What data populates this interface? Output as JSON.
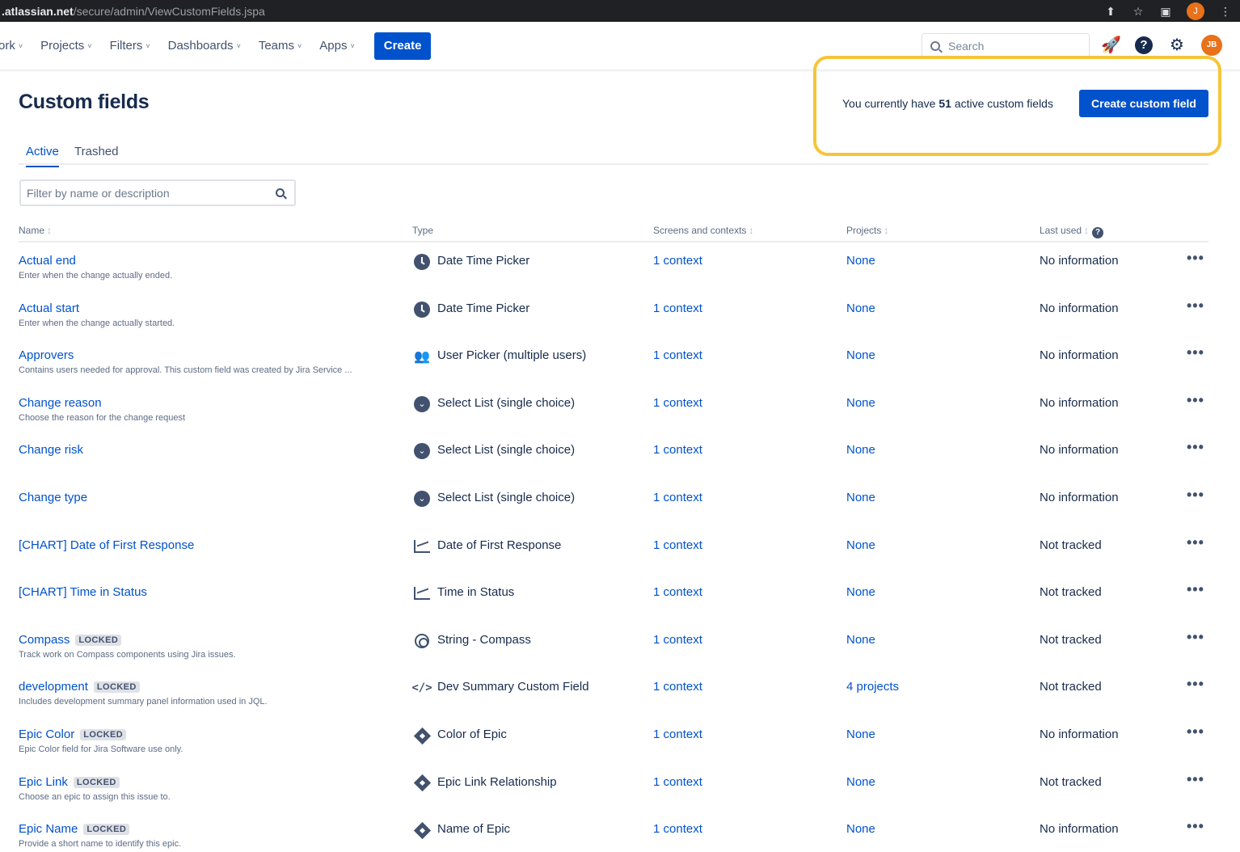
{
  "browser": {
    "url_host": ".atlassian.net",
    "url_path": "/secure/admin/ViewCustomFields.jspa",
    "profile_initial": "J"
  },
  "nav": {
    "items": [
      {
        "label": "ork"
      },
      {
        "label": "Projects"
      },
      {
        "label": "Filters"
      },
      {
        "label": "Dashboards"
      },
      {
        "label": "Teams"
      },
      {
        "label": "Apps"
      }
    ],
    "create_label": "Create",
    "search_placeholder": "Search",
    "avatar_initials": "JB"
  },
  "page": {
    "title": "Custom fields",
    "count_prefix": "You currently have",
    "count_value": "51",
    "count_suffix": "active custom fields",
    "create_button": "Create custom field",
    "tabs": [
      {
        "label": "Active",
        "active": true
      },
      {
        "label": "Trashed",
        "active": false
      }
    ],
    "filter_placeholder": "Filter by name or description"
  },
  "table": {
    "columns": {
      "name": "Name",
      "type": "Type",
      "screens": "Screens and contexts",
      "projects": "Projects",
      "last_used": "Last used"
    },
    "lock_label": "LOCKED",
    "rows": [
      {
        "name": "Actual end",
        "locked": false,
        "desc": "Enter when the change actually ended.",
        "type_icon": "clock",
        "type": "Date Time Picker",
        "context": "1 context",
        "projects": "None",
        "last_used": "No information"
      },
      {
        "name": "Actual start",
        "locked": false,
        "desc": "Enter when the change actually started.",
        "type_icon": "clock",
        "type": "Date Time Picker",
        "context": "1 context",
        "projects": "None",
        "last_used": "No information"
      },
      {
        "name": "Approvers",
        "locked": false,
        "desc": "Contains users needed for approval. This custom field was created by Jira Service ...",
        "type_icon": "users",
        "type": "User Picker (multiple users)",
        "context": "1 context",
        "projects": "None",
        "last_used": "No information"
      },
      {
        "name": "Change reason",
        "locked": false,
        "desc": "Choose the reason for the change request",
        "type_icon": "check",
        "type": "Select List (single choice)",
        "context": "1 context",
        "projects": "None",
        "last_used": "No information"
      },
      {
        "name": "Change risk",
        "locked": false,
        "desc": "",
        "type_icon": "check",
        "type": "Select List (single choice)",
        "context": "1 context",
        "projects": "None",
        "last_used": "No information"
      },
      {
        "name": "Change type",
        "locked": false,
        "desc": "",
        "type_icon": "check",
        "type": "Select List (single choice)",
        "context": "1 context",
        "projects": "None",
        "last_used": "No information"
      },
      {
        "name": "[CHART] Date of First Response",
        "locked": false,
        "desc": "",
        "type_icon": "chart",
        "type": "Date of First Response",
        "context": "1 context",
        "projects": "None",
        "last_used": "Not tracked"
      },
      {
        "name": "[CHART] Time in Status",
        "locked": false,
        "desc": "",
        "type_icon": "chart",
        "type": "Time in Status",
        "context": "1 context",
        "projects": "None",
        "last_used": "Not tracked"
      },
      {
        "name": "Compass",
        "locked": true,
        "desc": "Track work on Compass components using Jira issues.",
        "type_icon": "ring",
        "type": "String - Compass",
        "context": "1 context",
        "projects": "None",
        "last_used": "Not tracked"
      },
      {
        "name": "development",
        "locked": true,
        "desc": "Includes development summary panel information used in JQL.",
        "type_icon": "code",
        "type": "Dev Summary Custom Field",
        "context": "1 context",
        "projects": "4 projects",
        "last_used": "Not tracked"
      },
      {
        "name": "Epic Color",
        "locked": true,
        "desc": "Epic Color field for Jira Software use only.",
        "type_icon": "diamond",
        "type": "Color of Epic",
        "context": "1 context",
        "projects": "None",
        "last_used": "No information"
      },
      {
        "name": "Epic Link",
        "locked": true,
        "desc": "Choose an epic to assign this issue to.",
        "type_icon": "diamond",
        "type": "Epic Link Relationship",
        "context": "1 context",
        "projects": "None",
        "last_used": "Not tracked"
      },
      {
        "name": "Epic Name",
        "locked": true,
        "desc": "Provide a short name to identify this epic.",
        "type_icon": "diamond",
        "type": "Name of Epic",
        "context": "1 context",
        "projects": "None",
        "last_used": "No information"
      }
    ]
  }
}
